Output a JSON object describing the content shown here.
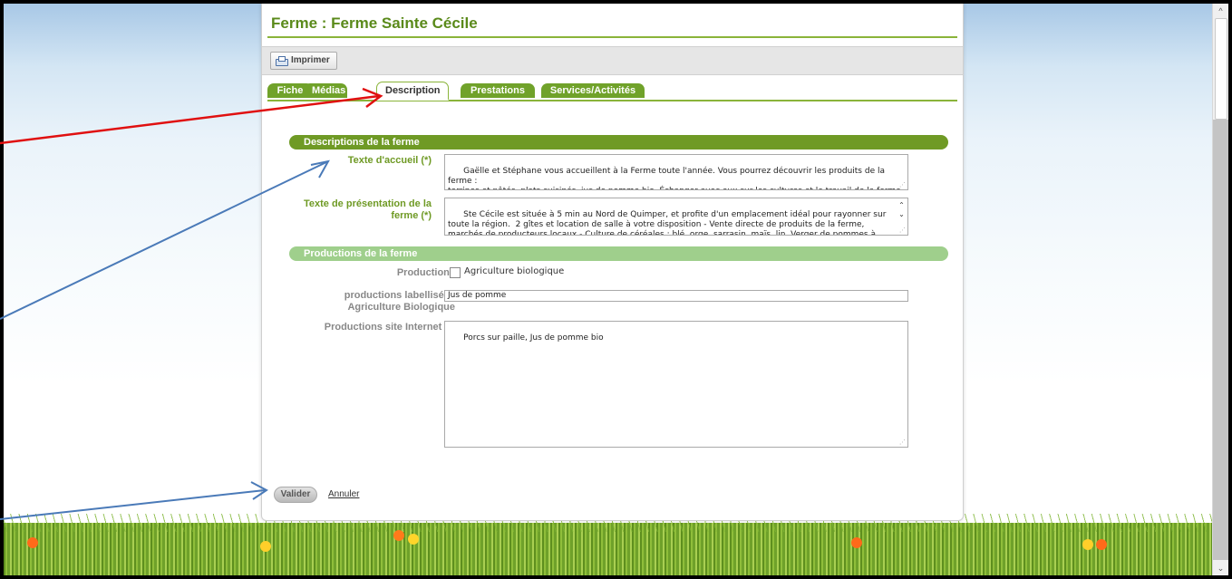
{
  "page": {
    "title": "Ferme : Ferme Sainte Cécile"
  },
  "toolbar": {
    "print_label": "Imprimer"
  },
  "tabs": [
    {
      "label": "Fiche",
      "active": false
    },
    {
      "label": "Médias",
      "active": false
    },
    {
      "label": "Description",
      "active": true
    },
    {
      "label": "Prestations",
      "active": false
    },
    {
      "label": "Services/Activités",
      "active": false
    }
  ],
  "section_description": {
    "title": "Descriptions de la ferme",
    "welcome_label": "Texte d'accueil (*)",
    "welcome_text": "Gaëlle et Stéphane vous accueillent à la Ferme toute l'année. Vous pourrez découvrir les produits de la ferme :\nterrines et pâtés, plats cuisinés, jus de pomme bio. Échanger avec eux sur les cultures et le travail de la ferme.\nSuivant les saisons, voir les cultures en place et faire un tour à travers champs.",
    "presentation_label": "Texte de présentation de la ferme (*)",
    "presentation_text": "Ste Cécile est située à 5 min au Nord de Quimper, et profite d'un emplacement idéal pour rayonner sur\ntoute la région.  2 gîtes et location de salle à votre disposition - Vente directe de produits de la ferme,\nmarchés de producteurs locaux - Culture de céréales : blé, orge, sarrasin, maïs, lin. Verger de pommes à"
  },
  "section_productions": {
    "title": "Productions de la ferme",
    "productions_label": "Productions",
    "organic_checkbox_label": "Agriculture biologique",
    "organic_checked": false,
    "labelled_label": "productions labellisées Agriculture Biologique",
    "labelled_value": "Jus de pomme",
    "website_label": "Productions site Internet (*)",
    "website_value": "Porcs sur paille, Jus de pomme bio"
  },
  "actions": {
    "validate_label": "Valider",
    "cancel_label": "Annuler"
  },
  "colors": {
    "brand_green": "#70a22a",
    "section_dark": "#6f9a25",
    "section_light": "#9fcf8c",
    "arrow_red": "#e01010",
    "arrow_blue": "#4a7ab8"
  }
}
